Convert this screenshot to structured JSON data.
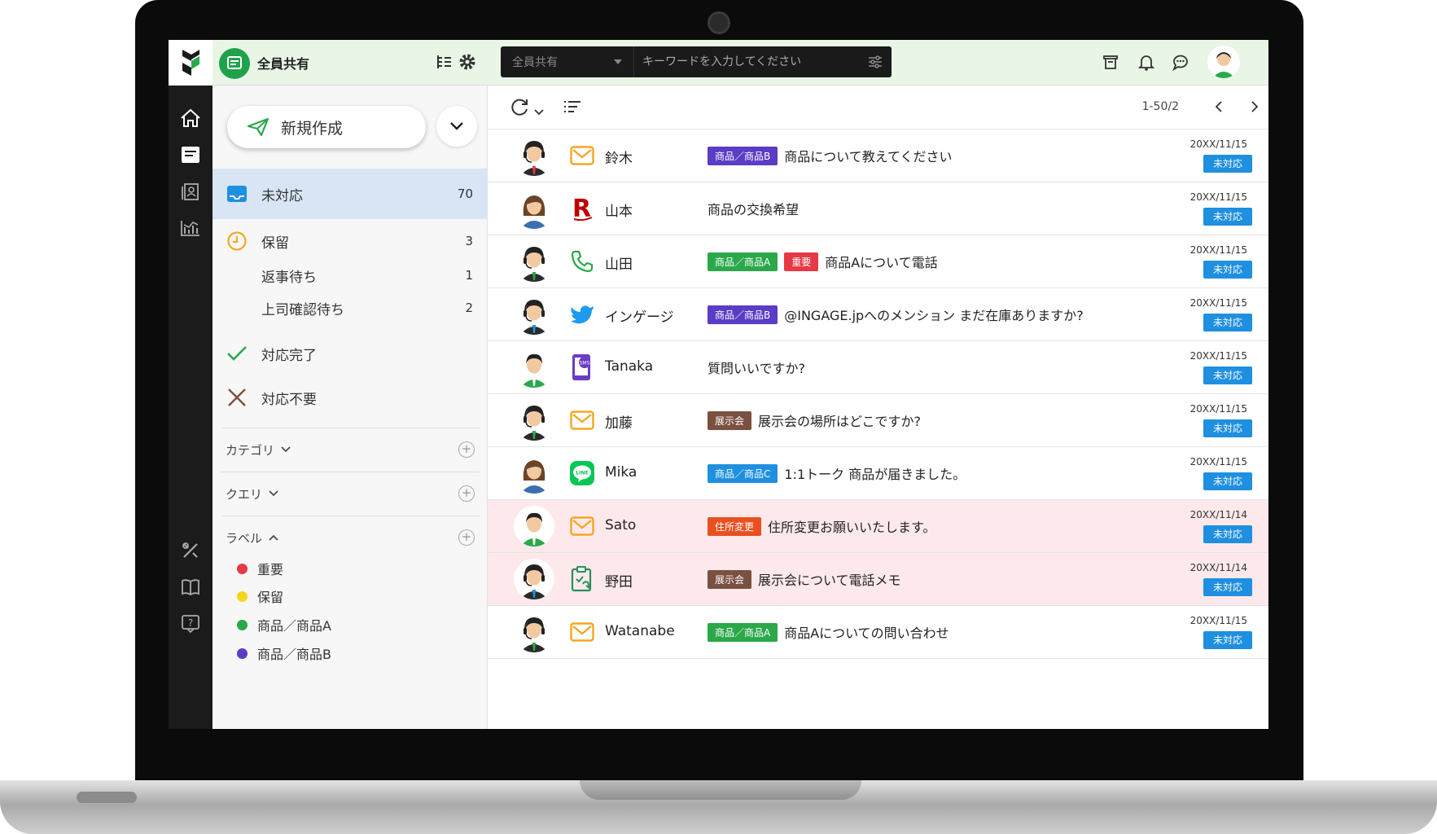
{
  "header": {
    "inbox_title": "全員共有",
    "search": {
      "scope": "全員共有",
      "placeholder": "キーワードを入力してください"
    }
  },
  "sidebar": {
    "new_button": "新規作成",
    "nav": [
      {
        "label": "未対応",
        "count": "70",
        "icon": "inbox-icon"
      },
      {
        "label": "保留",
        "count": "3",
        "icon": "clock-icon"
      },
      {
        "label": "返事待ち",
        "count": "1"
      },
      {
        "label": "上司確認待ち",
        "count": "2"
      },
      {
        "label": "対応完了",
        "icon": "check-icon"
      },
      {
        "label": "対応不要",
        "icon": "x-icon"
      }
    ],
    "sections": {
      "category": "カテゴリ",
      "query": "クエリ",
      "label": "ラベル"
    },
    "labels": [
      {
        "name": "重要",
        "color": "#e53945"
      },
      {
        "name": "保留",
        "color": "#f5d41e"
      },
      {
        "name": "商品／商品A",
        "color": "#2aa84a"
      },
      {
        "name": "商品／商品B",
        "color": "#5b3cc4"
      }
    ]
  },
  "list": {
    "pager": "1-50/2",
    "rows": [
      {
        "sender": "鈴木",
        "channel": "mail-icon",
        "tags": [
          {
            "text": "商品／商品B",
            "color": "#5b3cc4"
          }
        ],
        "subject": "商品について教えてください",
        "date": "20XX/11/15",
        "status": "未対応",
        "highlight": false
      },
      {
        "sender": "山本",
        "channel": "rakuten-icon",
        "tags": [],
        "subject": "商品の交換希望",
        "date": "20XX/11/15",
        "status": "未対応",
        "highlight": false
      },
      {
        "sender": "山田",
        "channel": "phone-icon",
        "tags": [
          {
            "text": "商品／商品A",
            "color": "#2aa84a"
          },
          {
            "text": "重要",
            "color": "#e53945"
          }
        ],
        "subject": "商品Aについて電話",
        "date": "20XX/11/15",
        "status": "未対応",
        "highlight": false
      },
      {
        "sender": "インゲージ",
        "channel": "twitter-icon",
        "tags": [
          {
            "text": "商品／商品B",
            "color": "#5b3cc4"
          }
        ],
        "subject": "@INGAGE.jpへのメンション まだ在庫ありますか?",
        "date": "20XX/11/15",
        "status": "未対応",
        "highlight": false
      },
      {
        "sender": "Tanaka",
        "channel": "sms-icon",
        "tags": [],
        "subject": "質問いいですか?",
        "date": "20XX/11/15",
        "status": "未対応",
        "highlight": false
      },
      {
        "sender": "加藤",
        "channel": "mail-icon",
        "tags": [
          {
            "text": "展示会",
            "color": "#7a5040"
          }
        ],
        "subject": "展示会の場所はどこですか?",
        "date": "20XX/11/15",
        "status": "未対応",
        "highlight": false
      },
      {
        "sender": "Mika",
        "channel": "line-icon",
        "tags": [
          {
            "text": "商品／商品C",
            "color": "#1f8fe0"
          }
        ],
        "subject": "1:1トーク 商品が届きました。",
        "date": "20XX/11/15",
        "status": "未対応",
        "highlight": false
      },
      {
        "sender": "Sato",
        "channel": "mail-icon",
        "tags": [
          {
            "text": "住所変更",
            "color": "#e8501f"
          }
        ],
        "subject": "住所変更お願いいたします。",
        "date": "20XX/11/14",
        "status": "未対応",
        "highlight": true
      },
      {
        "sender": "野田",
        "channel": "memo-icon",
        "tags": [
          {
            "text": "展示会",
            "color": "#7a5040"
          }
        ],
        "subject": "展示会について電話メモ",
        "date": "20XX/11/14",
        "status": "未対応",
        "highlight": true
      },
      {
        "sender": "Watanabe",
        "channel": "mail-icon",
        "tags": [
          {
            "text": "商品／商品A",
            "color": "#2aa84a"
          }
        ],
        "subject": "商品Aについての問い合わせ",
        "date": "20XX/11/15",
        "status": "未対応",
        "highlight": false
      }
    ]
  }
}
